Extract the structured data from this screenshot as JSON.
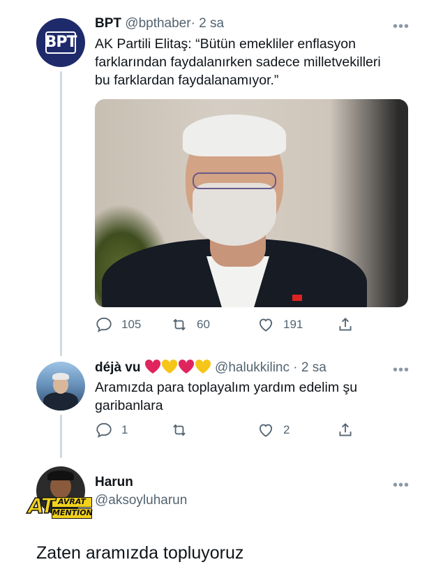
{
  "tweet1": {
    "name": "BPT",
    "handle": "@bpthaber",
    "time": "· 2 sa",
    "avatar_text": "BPT",
    "text_lines": [
      "AK Partili Elitaş: “Bütün emekliler enflasyon",
      "farklarından faydalanırken sadece milletvekilleri",
      "bu farklardan faydalanamıyor.”"
    ],
    "replies": "105",
    "retweets": "60",
    "likes": "191"
  },
  "tweet2": {
    "name": "déjà vu",
    "emojis": "❤️💛❤️💛",
    "handle": "@halukkilinc",
    "time": "· 2 sa",
    "text_lines": [
      "Aramızda para toplayalım yardım edelim şu",
      "garibanlara"
    ],
    "replies": "1",
    "retweets": "",
    "likes": "2"
  },
  "tweet3": {
    "name": "Harun",
    "handle": "@aksoyluharun",
    "badge_main": "AT",
    "badge_top": "AVRAT",
    "badge_bottom": "MENTION",
    "text": "Zaten aramızda topluyoruz"
  },
  "icons": {
    "reply": "reply-icon",
    "retweet": "retweet-icon",
    "like": "like-icon",
    "share": "share-icon",
    "more": "more-icon"
  },
  "colors": {
    "thread_line": "#cfd9de",
    "secondary_text": "#536471",
    "avatar_bpt": "#1f2a6b",
    "heart_red": "#e0245e",
    "heart_yellow": "#f5c518"
  }
}
